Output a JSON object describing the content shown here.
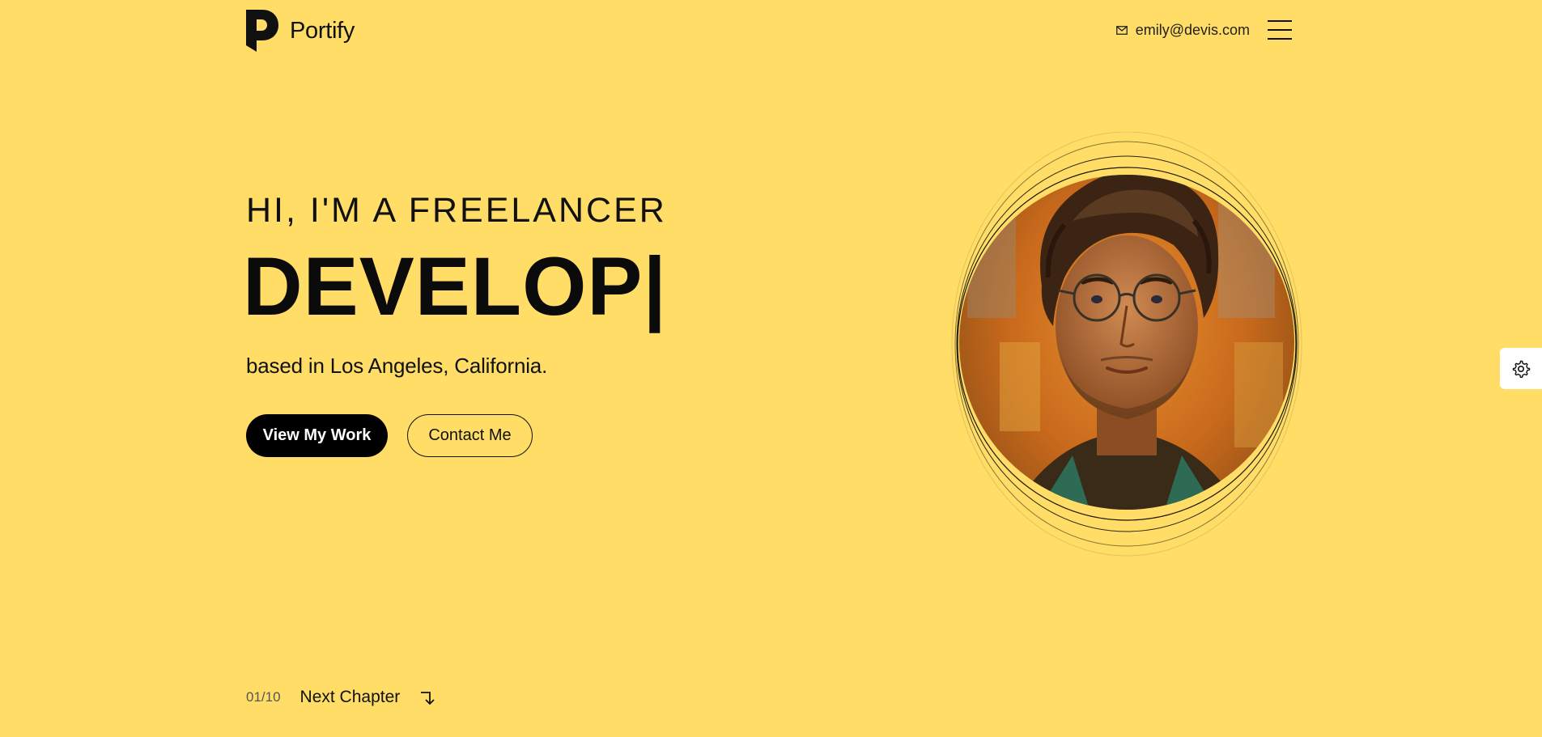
{
  "brand": {
    "name": "Portify",
    "logo_icon": "portify-p-logo-icon"
  },
  "header": {
    "email": "emily@devis.com",
    "email_icon": "mail-icon",
    "menu_icon": "hamburger-menu-icon"
  },
  "hero": {
    "subtitle": "Hi, I'm a Freelancer",
    "role": "DEVELOP|",
    "location": "based in Los Angeles, California.",
    "primary_button": "View My Work",
    "secondary_button": "Contact Me",
    "portrait_icon": "portrait-photo"
  },
  "settings": {
    "icon": "gear-icon"
  },
  "footer_nav": {
    "counter": "01/10",
    "next_label": "Next Chapter",
    "arrow_icon": "arrow-turn-down-icon"
  },
  "colors": {
    "background": "#ffdd66",
    "text": "#111111",
    "primary_button_bg": "#000000",
    "primary_button_text": "#ffffff"
  }
}
